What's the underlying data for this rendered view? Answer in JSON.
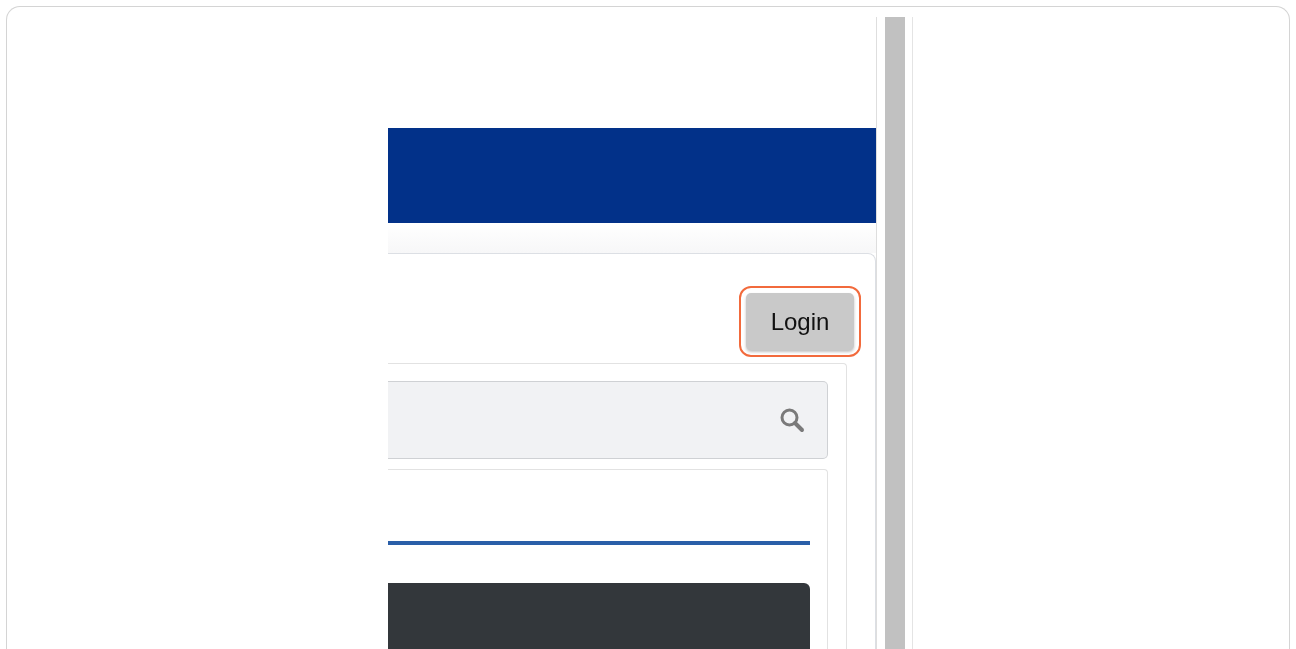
{
  "login_button": {
    "label": "Login",
    "highlighted": true
  }
}
